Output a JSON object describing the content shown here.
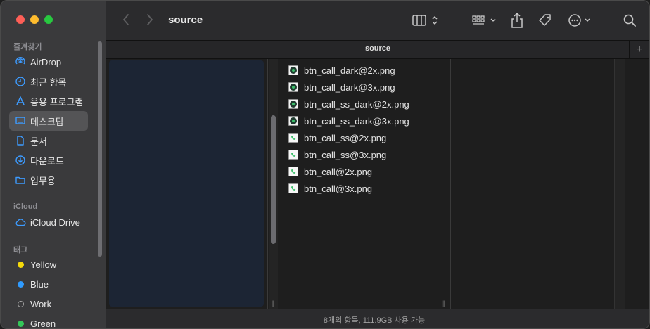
{
  "window": {
    "folder_title": "source"
  },
  "toolbar": {
    "title": "source"
  },
  "tabbar": {
    "title": "source",
    "plus": "+"
  },
  "sidebar": {
    "favorites_title": "즐겨찾기",
    "favorites": [
      {
        "label": "AirDrop",
        "icon": "airdrop-icon"
      },
      {
        "label": "최근 항목",
        "icon": "clock-icon"
      },
      {
        "label": "응용 프로그램",
        "icon": "apps-icon"
      },
      {
        "label": "데스크탑",
        "icon": "desktop-icon",
        "selected": true
      },
      {
        "label": "문서",
        "icon": "document-icon"
      },
      {
        "label": "다운로드",
        "icon": "download-icon"
      },
      {
        "label": "업무용",
        "icon": "folder-icon"
      }
    ],
    "icloud_title": "iCloud",
    "icloud": [
      {
        "label": "iCloud Drive",
        "icon": "cloud-icon"
      }
    ],
    "tags_title": "태그",
    "tags": [
      {
        "label": "Yellow",
        "color": "#f5d90a"
      },
      {
        "label": "Blue",
        "color": "#2f9bff"
      },
      {
        "label": "Work",
        "color": ""
      },
      {
        "label": "Green",
        "color": "#34c759"
      }
    ]
  },
  "files": [
    {
      "name": "btn_call_dark@2x.png",
      "style": "dark"
    },
    {
      "name": "btn_call_dark@3x.png",
      "style": "dark"
    },
    {
      "name": "btn_call_ss_dark@2x.png",
      "style": "dark"
    },
    {
      "name": "btn_call_ss_dark@3x.png",
      "style": "dark"
    },
    {
      "name": "btn_call_ss@2x.png",
      "style": "light"
    },
    {
      "name": "btn_call_ss@3x.png",
      "style": "light"
    },
    {
      "name": "btn_call@2x.png",
      "style": "light"
    },
    {
      "name": "btn_call@3x.png",
      "style": "light"
    }
  ],
  "status": {
    "text": "8개의 항목, 111.9GB 사용 가능"
  }
}
